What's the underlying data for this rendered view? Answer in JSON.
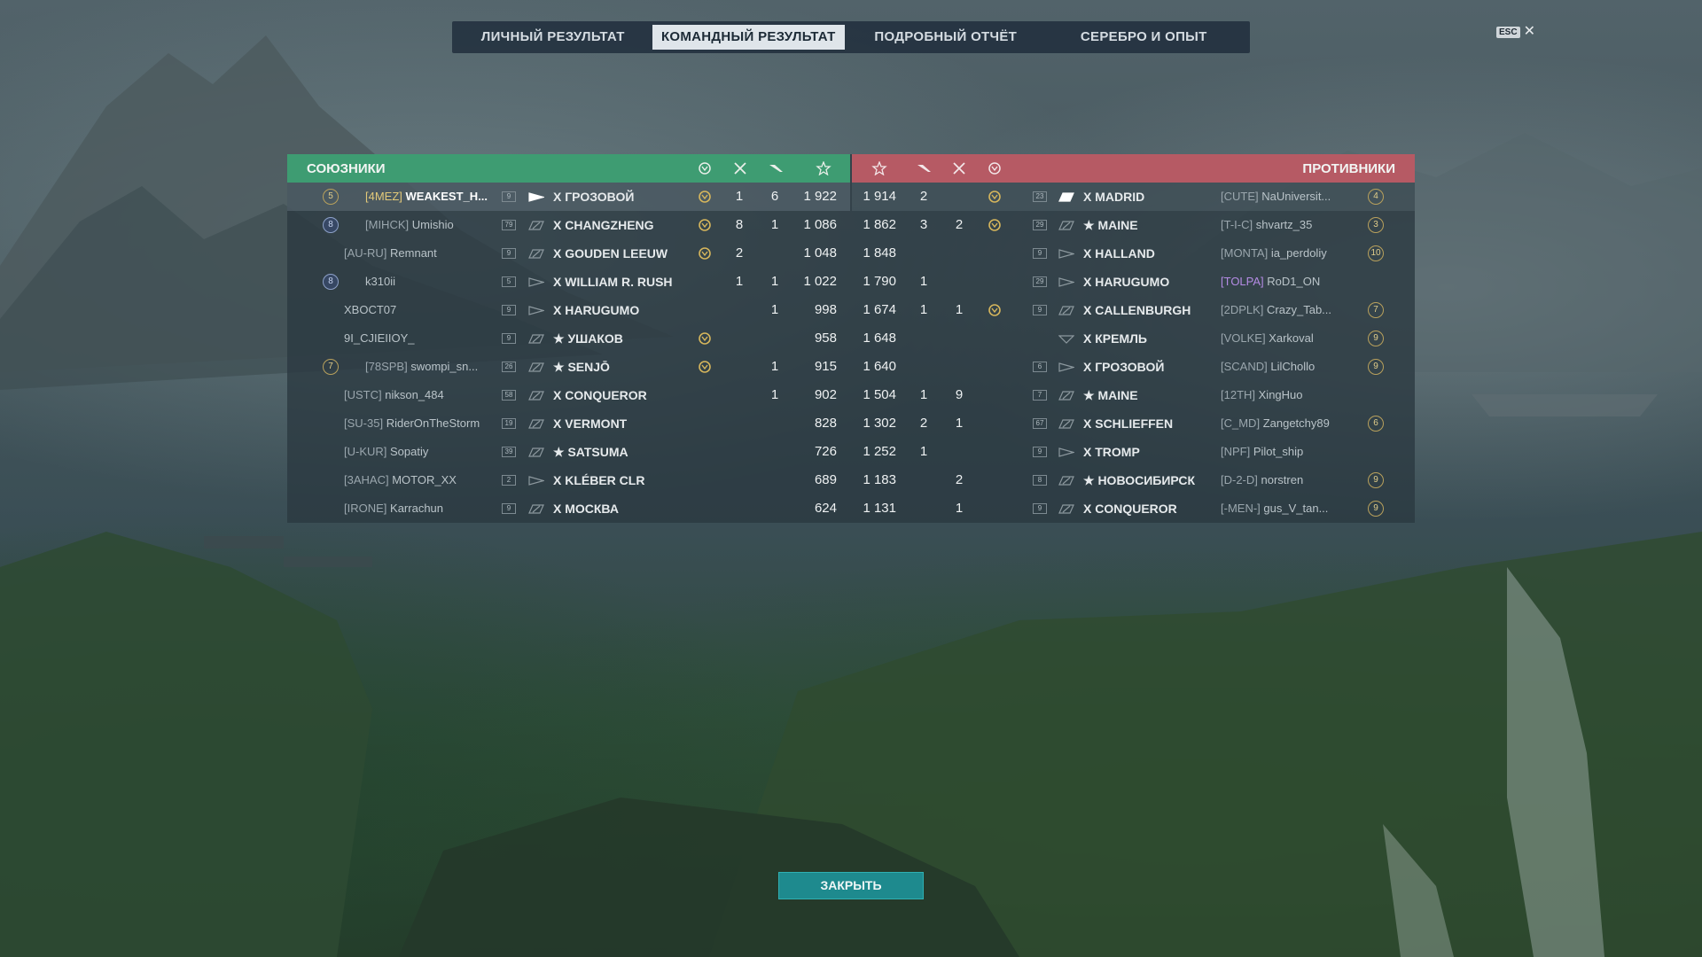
{
  "tabs": [
    {
      "label": "ЛИЧНЫЙ РЕЗУЛЬТАТ",
      "active": false
    },
    {
      "label": "КОМАНДНЫЙ РЕЗУЛЬТАТ",
      "active": true
    },
    {
      "label": "ПОДРОБНЫЙ ОТЧЁТ",
      "active": false
    },
    {
      "label": "СЕРЕБРО И ОПЫТ",
      "active": false
    }
  ],
  "esc_label": "ESC",
  "close_symbol": "✕",
  "allies_title": "СОЮЗНИКИ",
  "enemies_title": "ПРОТИВНИКИ",
  "column_icons": [
    "crown-medal-icon",
    "kill-icon",
    "plane-icon",
    "star-icon"
  ],
  "colors": {
    "ally": "#3e9c72",
    "enemy": "#b65a64",
    "button": "#1e8a8e"
  },
  "allies": [
    {
      "rank": "5",
      "rank_style": "gold",
      "clan": "[4MEZ]",
      "name": "WEAKEST_H...",
      "me": true,
      "tier": "9",
      "ship_class": "destroyer",
      "ship": "X ГРОЗОВОЙ",
      "medal": true,
      "kills": "1",
      "planes": "6",
      "exp": "1 922"
    },
    {
      "rank": "8",
      "rank_style": "blue",
      "clan": "[MIHCK]",
      "name": "Umishio",
      "me": false,
      "tier": "79",
      "ship_class": "battleship",
      "ship": "X CHANGZHENG",
      "medal": true,
      "kills": "8",
      "planes": "1",
      "exp": "1 086"
    },
    {
      "rank": "",
      "rank_style": "",
      "clan": "[AU-RU]",
      "name": "Remnant",
      "me": false,
      "tier": "9",
      "ship_class": "battleship",
      "ship": "X GOUDEN LEEUW",
      "medal": true,
      "kills": "2",
      "planes": "",
      "exp": "1 048"
    },
    {
      "rank": "8",
      "rank_style": "blue",
      "clan": "",
      "name": "k310ii",
      "me": false,
      "tier": "5",
      "ship_class": "destroyer",
      "ship": "X WILLIAM R. RUSH",
      "medal": false,
      "kills": "1",
      "planes": "1",
      "exp": "1 022"
    },
    {
      "rank": "",
      "rank_style": "",
      "clan": "",
      "name": "XBOCT07",
      "me": false,
      "tier": "9",
      "ship_class": "destroyer",
      "ship": "X HARUGUMO",
      "medal": false,
      "kills": "",
      "planes": "1",
      "exp": "998"
    },
    {
      "rank": "",
      "rank_style": "",
      "clan": "",
      "name": "9I_CJIEIIOY_",
      "me": false,
      "tier": "9",
      "ship_class": "battleship",
      "ship": "★ УШАКОВ",
      "medal": true,
      "kills": "",
      "planes": "",
      "exp": "958"
    },
    {
      "rank": "7",
      "rank_style": "gold",
      "clan": "[78SPB]",
      "name": "swompi_sn...",
      "me": false,
      "tier": "26",
      "ship_class": "battleship",
      "ship": "★ SENJŌ",
      "medal": true,
      "kills": "",
      "planes": "1",
      "exp": "915"
    },
    {
      "rank": "",
      "rank_style": "",
      "clan": "[USTC]",
      "name": "nikson_484",
      "me": false,
      "tier": "58",
      "ship_class": "battleship",
      "ship": "X CONQUEROR",
      "medal": false,
      "kills": "",
      "planes": "1",
      "exp": "902"
    },
    {
      "rank": "",
      "rank_style": "",
      "clan": "[SU-35]",
      "name": "RiderOnTheStorm",
      "me": false,
      "tier": "19",
      "ship_class": "battleship",
      "ship": "X VERMONT",
      "medal": false,
      "kills": "",
      "planes": "",
      "exp": "828"
    },
    {
      "rank": "",
      "rank_style": "",
      "clan": "[U-KUR]",
      "name": "Sopatiy",
      "me": false,
      "tier": "39",
      "ship_class": "battleship",
      "ship": "★ SATSUMA",
      "medal": false,
      "kills": "",
      "planes": "",
      "exp": "726"
    },
    {
      "rank": "",
      "rank_style": "",
      "clan": "[3AHAC]",
      "name": "MOTOR_XX",
      "me": false,
      "tier": "2",
      "ship_class": "destroyer",
      "ship": "X KLÉBER CLR",
      "medal": false,
      "kills": "",
      "planes": "",
      "exp": "689"
    },
    {
      "rank": "",
      "rank_style": "",
      "clan": "[IRONE]",
      "name": "Karrachun",
      "me": false,
      "tier": "9",
      "ship_class": "battleship",
      "ship": "X МОСКВА",
      "medal": false,
      "kills": "",
      "planes": "",
      "exp": "624"
    }
  ],
  "enemies": [
    {
      "exp": "1 914",
      "planes": "2",
      "kills": "",
      "medal": true,
      "tier": "23",
      "ship_class": "battleship-hl",
      "ship": "X MADRID",
      "clan": "[CUTE]",
      "clan_style": "",
      "name": "NaUniversit...",
      "rank": "4",
      "rank_style": "gold"
    },
    {
      "exp": "1 862",
      "planes": "3",
      "kills": "2",
      "medal": true,
      "tier": "29",
      "ship_class": "battleship",
      "ship": "★ MAINE",
      "clan": "[T-I-C]",
      "clan_style": "",
      "name": "shvartz_35",
      "rank": "3",
      "rank_style": "gold"
    },
    {
      "exp": "1 848",
      "planes": "",
      "kills": "",
      "medal": false,
      "tier": "9",
      "ship_class": "destroyer",
      "ship": "X HALLAND",
      "clan": "[MONTA]",
      "clan_style": "",
      "name": "ia_perdoliy",
      "rank": "10",
      "rank_style": "gold"
    },
    {
      "exp": "1 790",
      "planes": "1",
      "kills": "",
      "medal": false,
      "tier": "29",
      "ship_class": "destroyer",
      "ship": "X HARUGUMO",
      "clan": "[TOLPA]",
      "clan_style": "vio",
      "name": "RoD1_ON",
      "rank": "",
      "rank_style": ""
    },
    {
      "exp": "1 674",
      "planes": "1",
      "kills": "1",
      "medal": true,
      "tier": "9",
      "ship_class": "battleship",
      "ship": "X CALLENBURGH",
      "clan": "[2DPLK]",
      "clan_style": "",
      "name": "Crazy_Tab...",
      "rank": "7",
      "rank_style": "gold"
    },
    {
      "exp": "1 648",
      "planes": "",
      "kills": "",
      "medal": false,
      "tier": "",
      "ship_class": "carrier",
      "ship": "X КРЕМЛЬ",
      "clan": "[VOLKE]",
      "clan_style": "",
      "name": "Xarkoval",
      "rank": "9",
      "rank_style": "gold"
    },
    {
      "exp": "1 640",
      "planes": "",
      "kills": "",
      "medal": false,
      "tier": "6",
      "ship_class": "destroyer",
      "ship": "X ГРОЗОВОЙ",
      "clan": "[SCAND]",
      "clan_style": "",
      "name": "LilChollo",
      "rank": "9",
      "rank_style": "gold"
    },
    {
      "exp": "1 504",
      "planes": "1",
      "kills": "9",
      "medal": false,
      "tier": "7",
      "ship_class": "battleship",
      "ship": "★ MAINE",
      "clan": "[12TH]",
      "clan_style": "",
      "name": "XingHuo",
      "rank": "",
      "rank_style": ""
    },
    {
      "exp": "1 302",
      "planes": "2",
      "kills": "1",
      "medal": false,
      "tier": "67",
      "ship_class": "battleship",
      "ship": "X SCHLIEFFEN",
      "clan": "[C_MD]",
      "clan_style": "",
      "name": "Zangetchy89",
      "rank": "6",
      "rank_style": "gold"
    },
    {
      "exp": "1 252",
      "planes": "1",
      "kills": "",
      "medal": false,
      "tier": "9",
      "ship_class": "destroyer",
      "ship": "X TROMP",
      "clan": "[NPF]",
      "clan_style": "",
      "name": "Pilot_ship",
      "rank": "",
      "rank_style": ""
    },
    {
      "exp": "1 183",
      "planes": "",
      "kills": "2",
      "medal": false,
      "tier": "8",
      "ship_class": "battleship",
      "ship": "★ НОВОСИБИРСК",
      "clan": "[D-2-D]",
      "clan_style": "",
      "name": "norstren",
      "rank": "9",
      "rank_style": "gold"
    },
    {
      "exp": "1 131",
      "planes": "",
      "kills": "1",
      "medal": false,
      "tier": "9",
      "ship_class": "battleship",
      "ship": "X CONQUEROR",
      "clan": "[-MEN-]",
      "clan_style": "",
      "name": "gus_V_tan...",
      "rank": "9",
      "rank_style": "gold"
    }
  ],
  "close_button_label": "ЗАКРЫТЬ"
}
